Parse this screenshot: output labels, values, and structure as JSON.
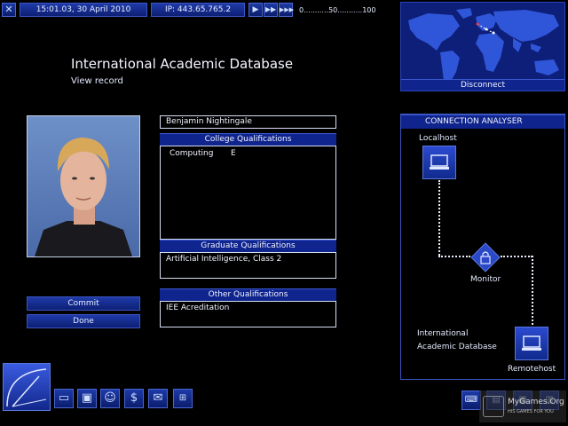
{
  "top_bar": {
    "datetime": "15:01.03, 30 April 2010",
    "ip": "IP: 443.65.765.2",
    "speed_scale": "0...........50...........100"
  },
  "world_map": {
    "disconnect_label": "Disconnect"
  },
  "record": {
    "title": "International Academic Database",
    "subtitle": "View record",
    "name": "Benjamin Nightingale",
    "college_header": "College Qualifications",
    "college_subject": "Computing",
    "college_grade": "E",
    "graduate_header": "Graduate Qualifications",
    "graduate_value": "Artificial Intelligence, Class 2",
    "other_header": "Other Qualifications",
    "other_value": "IEE Acreditation",
    "commit_label": "Commit",
    "done_label": "Done"
  },
  "analyser": {
    "title": "CONNECTION ANALYSER",
    "localhost_label": "Localhost",
    "monitor_label": "Monitor",
    "target_label_1": "International",
    "target_label_2": "Academic Database",
    "remotehost_label": "Remotehost"
  },
  "watermark": {
    "line1": "MyGames.Org",
    "line2": "HIS GAMES FOR YOU"
  },
  "colors": {
    "accent": "#1a36a6",
    "background": "#000000",
    "text": "#e6ecff"
  }
}
